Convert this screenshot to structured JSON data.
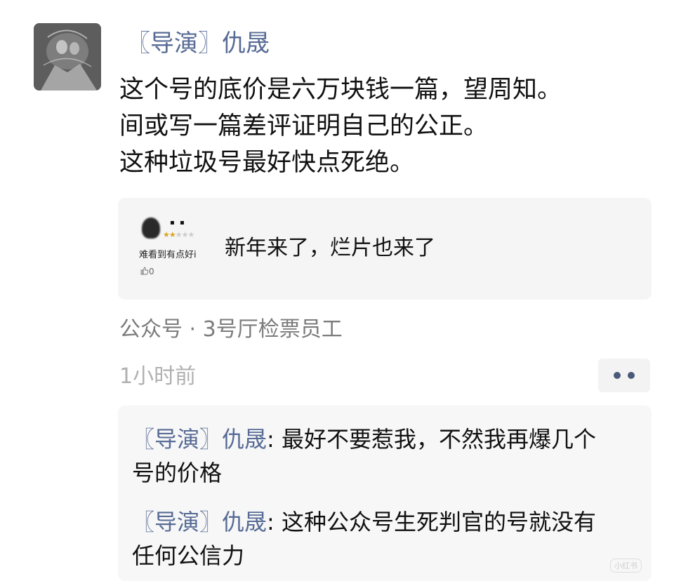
{
  "comment": {
    "author": "〖导演〗仇晟",
    "lines": [
      "这个号的底价是六万块钱一篇，望周知。",
      "间或写一篇差评证明自己的公正。",
      "这种垃圾号最好快点死绝。"
    ]
  },
  "quoted_article": {
    "thumb_dots": "▪ ▪",
    "thumb_stars_on": "★★",
    "thumb_stars_off": "★★★",
    "thumb_snippet": "难看到有点好i",
    "thumb_likes": "0",
    "title": "新年来了，烂片也来了"
  },
  "meta": {
    "source": "公众号 · 3号厅检票员工",
    "time": "1小时前"
  },
  "replies": [
    {
      "author": "〖导演〗仇晟",
      "text_line1": "最好不要惹我，不然我再爆几个",
      "text_line2": "号的价格"
    },
    {
      "author": "〖导演〗仇晟",
      "text_line1": "这种公众号生死判官的号就没有",
      "text_line2": "任何公信力"
    }
  ],
  "watermark": "小红书",
  "colors": {
    "author_link": "#576b95",
    "card_bg": "#f5f5f5",
    "meta_gray": "#7b7b7b"
  }
}
